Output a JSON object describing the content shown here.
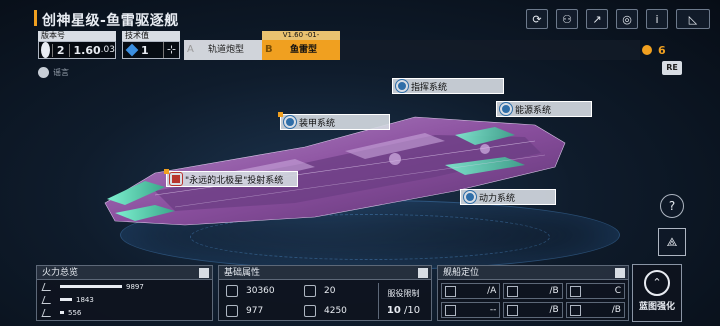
{
  "header": {
    "title": "创神星级-鱼雷驱逐舰",
    "icons": [
      "refresh-icon",
      "share-person-icon",
      "external-link-icon",
      "focus-icon",
      "info-icon",
      "camera-angle-icon"
    ]
  },
  "version": {
    "label": "版本号",
    "major": "2",
    "minor": "1.60",
    "sub": ".03"
  },
  "tech": {
    "label": "技术值",
    "value": "1"
  },
  "variants": {
    "a": {
      "letter": "A",
      "label": "轨道炮型"
    },
    "b": {
      "letter": "B",
      "label": "鱼雷型",
      "version_tag": "V1.60 -01-"
    }
  },
  "currency": {
    "value": "6"
  },
  "rumor": {
    "label": "谣言"
  },
  "re_button": {
    "label": "RE"
  },
  "systems": {
    "command": "指挥系统",
    "energy": "能源系统",
    "armor": "装甲系统",
    "torpedo": "\"永远的北极星\"投射系统",
    "power": "动力系统"
  },
  "help_button": {
    "label": "?"
  },
  "panels": {
    "fire": {
      "title": "火力总览",
      "rows": [
        {
          "value": "9897",
          "level": 1.0
        },
        {
          "value": "1843",
          "level": 0.19
        },
        {
          "value": "556",
          "level": 0.06
        }
      ]
    },
    "base": {
      "title": "基础属性",
      "stats": [
        {
          "value": "30360"
        },
        {
          "value": "20"
        },
        {
          "value": "977"
        },
        {
          "value": "4250"
        }
      ],
      "limit_label": "服役限制",
      "limit_current": "10",
      "limit_max": "/10"
    },
    "position": {
      "title": "舰船定位",
      "cells": [
        {
          "value": "/A"
        },
        {
          "value": "/B"
        },
        {
          "value": "C"
        },
        {
          "value": "--"
        },
        {
          "value": "/B"
        },
        {
          "value": "/B"
        }
      ]
    }
  },
  "upgrade_button": {
    "label": "蓝图强化"
  },
  "colors": {
    "accent": "#f0a020",
    "panel_bg": "#0e141e",
    "hull_purple": "#8a4f9e",
    "hull_teal": "#6ad6b8"
  }
}
